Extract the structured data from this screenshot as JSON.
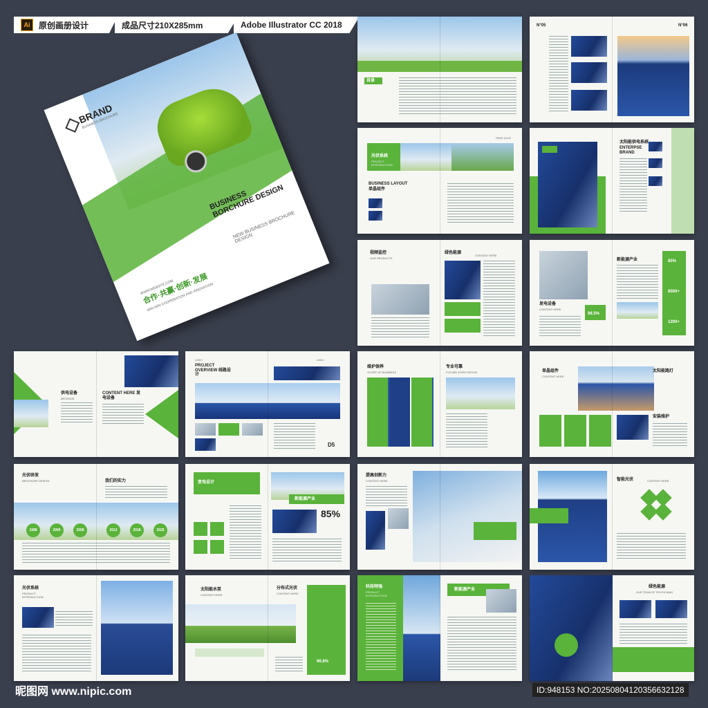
{
  "tags": {
    "ai_icon": "Ai",
    "title": "原创画册设计",
    "size": "成品尺寸210X285mm",
    "software": "Adobe Illustrator CC 2018"
  },
  "cover": {
    "brand": "BRAND",
    "brand_sub": "BUSINESS BROCHURE",
    "title": "BUSINESS BORCHURE DESIGN",
    "subtitle": "NEW BUSINESS BROCHURE DESIGN",
    "website": "WWW.WEBSITE.COM",
    "slogan": "合作·共赢·创新·发展",
    "slogan_en": "WIN-WIN COOPERATION AND INNOVATION"
  },
  "spreads": {
    "s1": {
      "label": "目录"
    },
    "s2": {
      "left": "N°05",
      "right": "N°06"
    },
    "s3": {
      "title": "光伏系统",
      "sub": "PROJECT INTRODUCTION",
      "layout": "BUSINESS LAYOUT",
      "layout_cn": "单晶组件",
      "page": "PAGE 01/02"
    },
    "s4": {
      "title": "太阳能供电系统",
      "en": "ENTERPSE BRAND"
    },
    "s5": {
      "title": "视频监控",
      "sub": "OUR PRODUCTS",
      "right": "绿色能源",
      "right_sub": "CONTENT HERE"
    },
    "s6": {
      "title": "新能源产业",
      "stat1": "85%",
      "stat2": "98.5%",
      "stat3": "8500+",
      "stat4": "1200+",
      "title2": "发电设备",
      "sub2": "CONTENT HERE"
    },
    "s7": {
      "title": "供电设备",
      "sub": "MESSAGE",
      "right": "CONTENT HERE 发电设备"
    },
    "s8": {
      "title": "PROJECT OVERVIEW 线路设计",
      "num": "D5",
      "left_num": "L000 /",
      "right_num": "L000 /"
    },
    "s9": {
      "title": "维护保养",
      "sub": "SCOPE OF BUSINESS",
      "right": "专业可靠",
      "right_sub": "FUTURE EXPECTATION"
    },
    "s10": {
      "title": "单晶组件",
      "sub": "CONTENT HERE",
      "right": "太阳能路灯",
      "right2": "安装维护"
    },
    "s11": {
      "title": "光伏研发",
      "sub": "BROCHURE DESIGN",
      "right": "我们的实力",
      "years": [
        "1998",
        "2000",
        "2008",
        "2012",
        "2018",
        "2025"
      ]
    },
    "s12": {
      "title": "变电设计",
      "right": "新能源产业",
      "stat": "85%"
    },
    "s13": {
      "title": "提高创新力",
      "sub": "CONTENT HERE"
    },
    "s14": {
      "title": "智能光伏",
      "sub": "CONTENT HERE"
    },
    "s15": {
      "title": "光伏系统",
      "sub": "PRODUCT INTRODUCTION"
    },
    "s16": {
      "title": "太阳能水泵",
      "sub": "CONTENT HERE",
      "right": "分布式光伏",
      "right_sub": "CONTENT HERE",
      "stat": "96.8%"
    },
    "s17": {
      "title": "科技特强",
      "sub": "PRODUCT INTRODUCTION",
      "right": "新能源产业"
    },
    "s18": {
      "title": "绿色能源",
      "sub": "OUR TEAM OF PHYSICIANS"
    }
  },
  "footer": {
    "logo": "昵图网 www.nipic.com",
    "id": "ID:948153 NO:20250804120356632128"
  }
}
